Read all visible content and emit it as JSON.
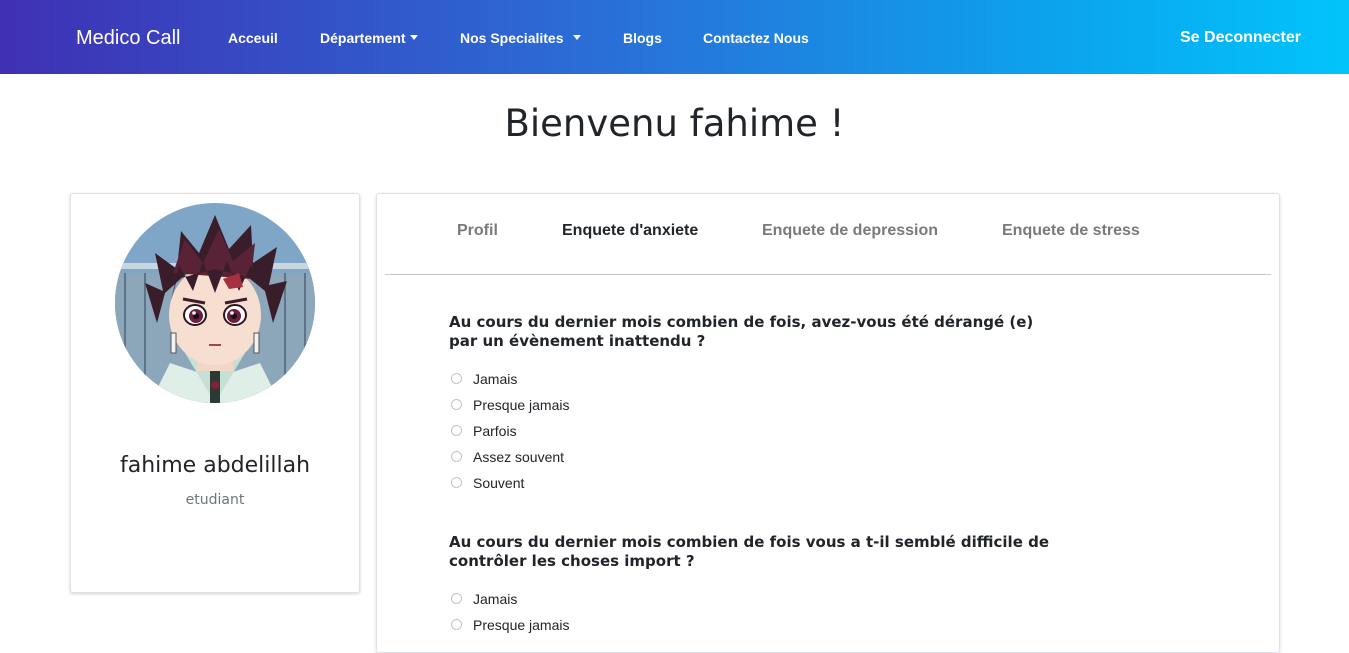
{
  "navbar": {
    "brand": "Medico Call",
    "items": [
      {
        "label": "Acceuil"
      },
      {
        "label": "Département"
      },
      {
        "label": "Nos Specialites"
      },
      {
        "label": "Blogs"
      },
      {
        "label": "Contactez Nous"
      }
    ],
    "logout_label": "Se Deconnecter",
    "gradient": [
      "#3f30b4",
      "#02c4fb"
    ]
  },
  "page": {
    "welcome": "Bienvenu fahime !"
  },
  "profile": {
    "name": "fahime abdelillah",
    "role": "etudiant",
    "avatar_icon": "anime-avatar"
  },
  "tabs": [
    {
      "label": "Profil",
      "active": false
    },
    {
      "label": "Enquete d'anxiete",
      "active": true
    },
    {
      "label": "Enquete de depression",
      "active": false
    },
    {
      "label": "Enquete de stress",
      "active": false
    }
  ],
  "survey": {
    "questions": [
      {
        "text": "Au cours du dernier mois combien de fois, avez-vous été dérangé (e) par un évènement inattendu ?",
        "options": [
          "Jamais",
          "Presque jamais",
          "Parfois",
          "Assez souvent",
          "Souvent"
        ]
      },
      {
        "text": "Au cours du dernier mois combien de fois vous a t-il semblé difficile de contrôler les choses import ?",
        "options": [
          "Jamais",
          "Presque jamais"
        ]
      }
    ]
  }
}
